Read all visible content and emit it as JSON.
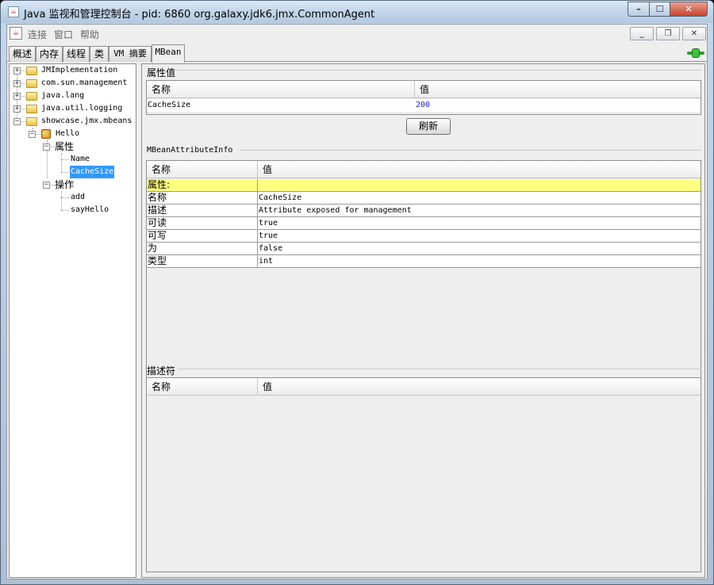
{
  "window": {
    "title": "Java 监视和管理控制台 - pid: 6860 org.galaxy.jdk6.jmx.CommonAgent"
  },
  "menu": {
    "items": [
      "连接",
      "窗口",
      "帮助"
    ]
  },
  "tabs": [
    "概述",
    "内存",
    "线程",
    "类",
    "VM 摘要",
    "MBean"
  ],
  "active_tab": "MBean",
  "tree": {
    "jmimpl": "JMImplementation",
    "comsun": "com.sun.management",
    "javalang": "java.lang",
    "javalogging": "java.util.logging",
    "showcase": "showcase.jmx.mbeans",
    "hello": "Hello",
    "attributes": "属性",
    "attr_name": "Name",
    "attr_cachesize": "CacheSize",
    "operations": "操作",
    "op_add": "add",
    "op_sayhello": "sayHello"
  },
  "attribute_values": {
    "title": "属性值",
    "headers": [
      "名称",
      "值"
    ],
    "row": {
      "name": "CacheSize",
      "value": "200"
    },
    "refresh_label": "刷新"
  },
  "attribute_info": {
    "title": "MBeanAttributeInfo",
    "headers": [
      "名称",
      "值"
    ],
    "rows": [
      {
        "name": "属性:",
        "value": ""
      },
      {
        "name": "名称",
        "value": "CacheSize"
      },
      {
        "name": "描述",
        "value": "Attribute exposed for management"
      },
      {
        "name": "可读",
        "value": "true"
      },
      {
        "name": "可写",
        "value": "true"
      },
      {
        "name": "为",
        "value": "false"
      },
      {
        "name": "类型",
        "value": "int"
      }
    ]
  },
  "descriptor": {
    "title": "描述符",
    "headers": [
      "名称",
      "值"
    ]
  },
  "colors": {
    "selection": "#3399ff",
    "highlight_row": "#ffff80",
    "value_link": "#2020d0"
  }
}
